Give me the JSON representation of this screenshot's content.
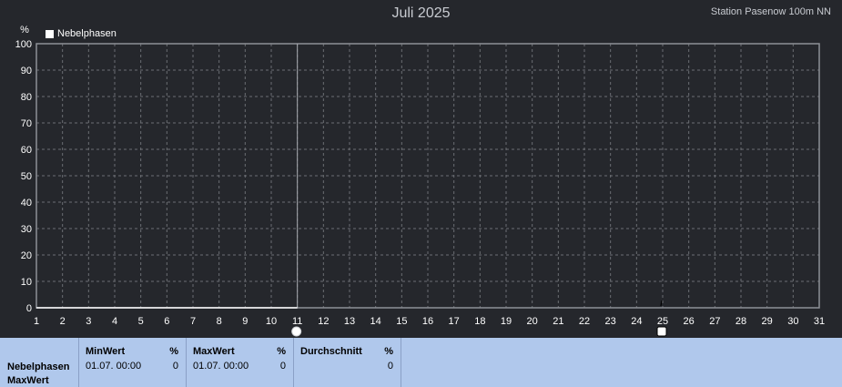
{
  "header": {
    "title": "Juli 2025",
    "station": "Station Pasenow 100m NN"
  },
  "chart_data": {
    "type": "line",
    "title": "Juli 2025",
    "ylabel": "%",
    "xlabel": "",
    "ylim": [
      0,
      100
    ],
    "xlim": [
      1,
      31
    ],
    "x_ticks": [
      1,
      2,
      3,
      4,
      5,
      6,
      7,
      8,
      9,
      10,
      11,
      12,
      13,
      14,
      15,
      16,
      17,
      18,
      19,
      20,
      21,
      22,
      23,
      24,
      25,
      26,
      27,
      28,
      29,
      30,
      31
    ],
    "y_ticks": [
      0,
      10,
      20,
      30,
      40,
      50,
      60,
      70,
      80,
      90,
      100
    ],
    "grid": true,
    "legend": "top-left",
    "series": [
      {
        "name": "Nebelphasen",
        "color": "#ffffff",
        "x": [
          1,
          11
        ],
        "y": [
          0,
          0
        ]
      }
    ],
    "cursor_x": 11,
    "markers": [
      11,
      25
    ]
  },
  "stats": {
    "series_name": "Nebelphasen",
    "series_sub": "MaxWert",
    "columns": [
      {
        "header": "MinWert",
        "unit": "%",
        "date": "01.07.  00:00",
        "value": "0"
      },
      {
        "header": "MaxWert",
        "unit": "%",
        "date": "01.07.  00:00",
        "value": "0"
      },
      {
        "header": "Durchschnitt",
        "unit": "%",
        "date": "",
        "value": "0"
      }
    ]
  },
  "colors": {
    "background": "#25272c",
    "grid": "#6b6e73",
    "frame": "#8d9096",
    "stats_bg": "#b0c8ec"
  }
}
